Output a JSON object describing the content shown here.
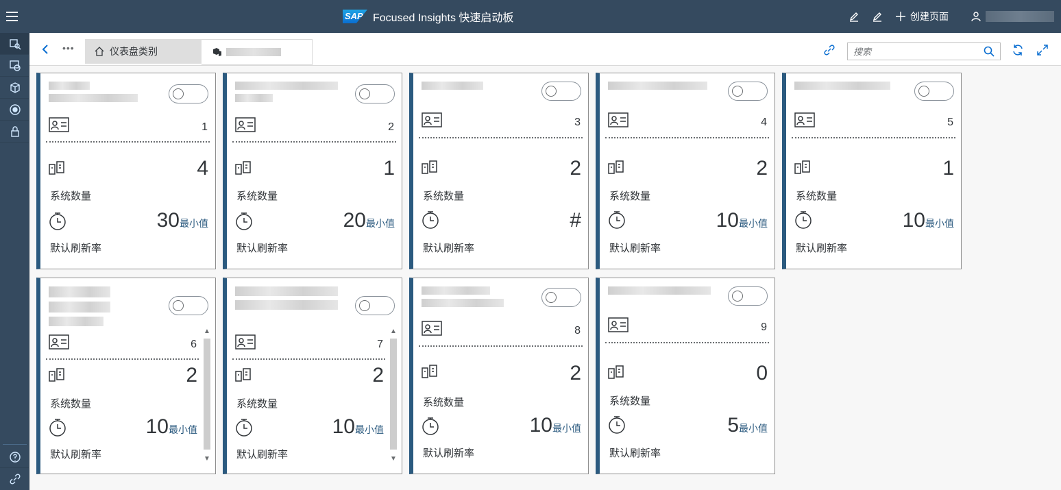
{
  "shell": {
    "title": "Focused Insights 快速启动板",
    "logo_text": "SAP",
    "create_page": "创建页面",
    "user_name": ""
  },
  "subheader": {
    "breadcrumb_home": "仪表盘类别",
    "breadcrumb_current": "",
    "search_placeholder": "搜索"
  },
  "tiles": [
    {
      "id": "1",
      "systems": "4",
      "rate": "30",
      "rate_unit": "最小值",
      "systems_label": "系统数量",
      "rate_label": "默认刷新率"
    },
    {
      "id": "2",
      "systems": "1",
      "rate": "20",
      "rate_unit": "最小值",
      "systems_label": "系统数量",
      "rate_label": "默认刷新率"
    },
    {
      "id": "3",
      "systems": "2",
      "rate": "#",
      "rate_unit": "",
      "systems_label": "系统数量",
      "rate_label": "默认刷新率"
    },
    {
      "id": "4",
      "systems": "2",
      "rate": "10",
      "rate_unit": "最小值",
      "systems_label": "系统数量",
      "rate_label": "默认刷新率"
    },
    {
      "id": "5",
      "systems": "1",
      "rate": "10",
      "rate_unit": "最小值",
      "systems_label": "系统数量",
      "rate_label": "默认刷新率"
    },
    {
      "id": "6",
      "systems": "2",
      "rate": "10",
      "rate_unit": "最小值",
      "systems_label": "系统数量",
      "rate_label": "默认刷新率"
    },
    {
      "id": "7",
      "systems": "2",
      "rate": "10",
      "rate_unit": "最小值",
      "systems_label": "系统数量",
      "rate_label": "默认刷新率"
    },
    {
      "id": "8",
      "systems": "2",
      "rate": "10",
      "rate_unit": "最小值",
      "systems_label": "系统数量",
      "rate_label": "默认刷新率"
    },
    {
      "id": "9",
      "systems": "0",
      "rate": "5",
      "rate_unit": "最小值",
      "systems_label": "系统数量",
      "rate_label": "默认刷新率"
    }
  ],
  "colors": {
    "shell": "#354a5f",
    "accent": "#2b5a7f",
    "link": "#0a6ed1"
  },
  "icons": [
    "menu-icon",
    "edit-icon",
    "add-icon",
    "user-icon",
    "back-icon",
    "home-icon",
    "link-icon",
    "search-icon",
    "refresh-icon",
    "fullscreen-icon",
    "id-card-icon",
    "systems-icon",
    "timer-icon",
    "help-icon"
  ]
}
